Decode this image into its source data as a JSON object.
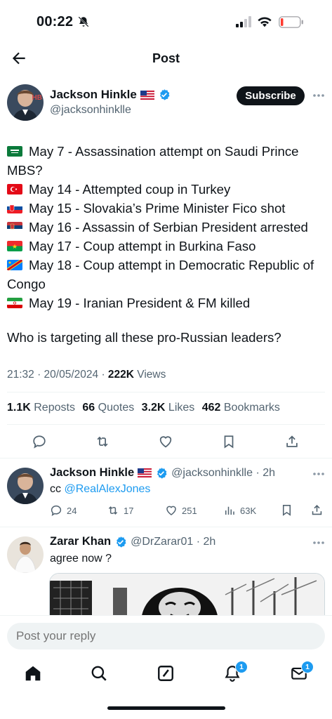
{
  "status_bar": {
    "time": "00:22"
  },
  "nav": {
    "title": "Post"
  },
  "author": {
    "name": "Jackson Hinkle",
    "handle": "@jacksonhinklle",
    "subscribe_label": "Subscribe",
    "avatar_initials": "HB"
  },
  "tweet": {
    "lines": [
      {
        "flag": "SA",
        "text": "May 7 - Assassination attempt on Saudi Prince MBS?"
      },
      {
        "flag": "TR",
        "text": "May 14 - Attempted coup in Turkey"
      },
      {
        "flag": "SK",
        "text": "May 15 - Slovakia’s Prime Minister Fico shot"
      },
      {
        "flag": "RS",
        "text": "May 16 - Assassin of Serbian President arrested"
      },
      {
        "flag": "BF",
        "text": "May 17 - Coup attempt in Burkina Faso"
      },
      {
        "flag": "CD",
        "text": "May 18 - Coup attempt in Democratic Republic of Congo"
      },
      {
        "flag": "IR",
        "text": "May 19 - Iranian President & FM killed"
      }
    ],
    "question": "Who is targeting all these pro-Russian leaders?",
    "timestamp": "21:32 · 20/05/2024 · ",
    "views_count": "222K",
    "views_label": " Views"
  },
  "stats": {
    "reposts_count": "1.1K",
    "reposts_label": " Reposts",
    "quotes_count": "66",
    "quotes_label": " Quotes",
    "likes_count": "3.2K",
    "likes_label": " Likes",
    "bookmarks_count": "462",
    "bookmarks_label": " Bookmarks"
  },
  "reply1": {
    "name": "Jackson Hinkle",
    "handle": "@jacksonhinklle · 2h",
    "text_prefix": "cc ",
    "mention": "@RealAlexJones",
    "replies": "24",
    "reposts": "17",
    "likes": "251",
    "views": "63K"
  },
  "reply2": {
    "name": "Zarar Khan",
    "handle": "@DrZarar01 · 2h",
    "text": "agree now ?"
  },
  "composer": {
    "placeholder": "Post your reply"
  },
  "tabs": {
    "notifications_badge": "1",
    "messages_badge": "1"
  },
  "colors": {
    "accent": "#1d9bf0",
    "text": "#0f1419",
    "muted": "#536471"
  }
}
